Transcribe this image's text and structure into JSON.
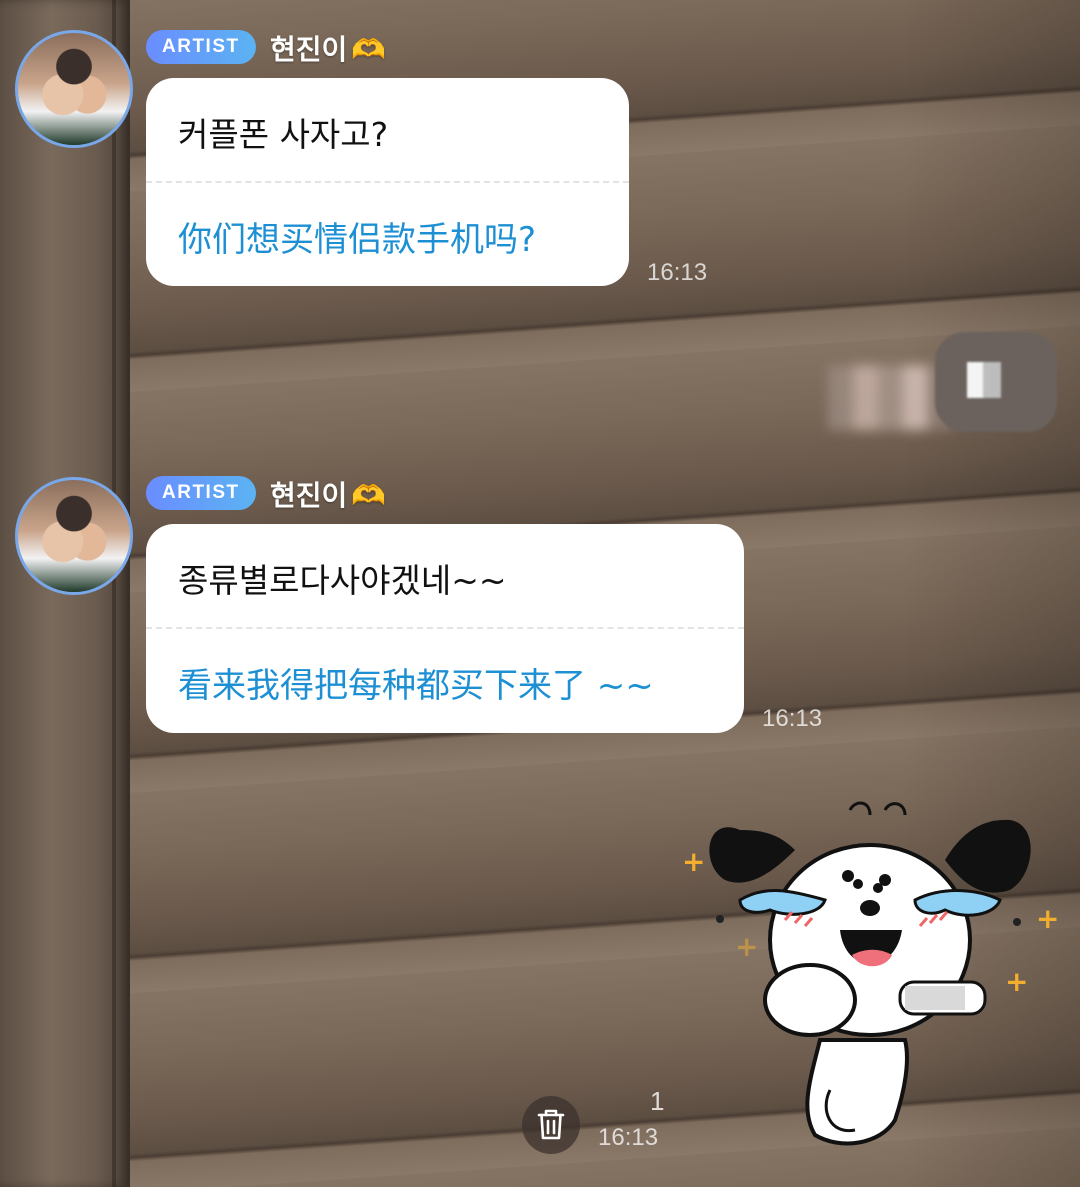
{
  "messages": [
    {
      "badge": "ARTIST",
      "sender": "현진이",
      "heart_emoji": "🫶",
      "original": "커플폰 사자고?",
      "translation": "你们想买情侣款手机吗?",
      "time": "16:13"
    },
    {
      "badge": "ARTIST",
      "sender": "현진이",
      "heart_emoji": "🫶",
      "original": "종류별로다사야겠네~~",
      "translation": "看来我得把每种都买下来了 ~~",
      "time": "16:13"
    }
  ],
  "user_sticker": {
    "sticker_name": "crying-puppy-sticker",
    "read_count": "1",
    "time": "16:13",
    "delete_icon": "trash-icon"
  },
  "colors": {
    "badge_gradient_start": "#6a8dff",
    "badge_gradient_end": "#5bb3f2",
    "translation_text": "#1d90d4",
    "avatar_ring": "#7aa7e8"
  }
}
